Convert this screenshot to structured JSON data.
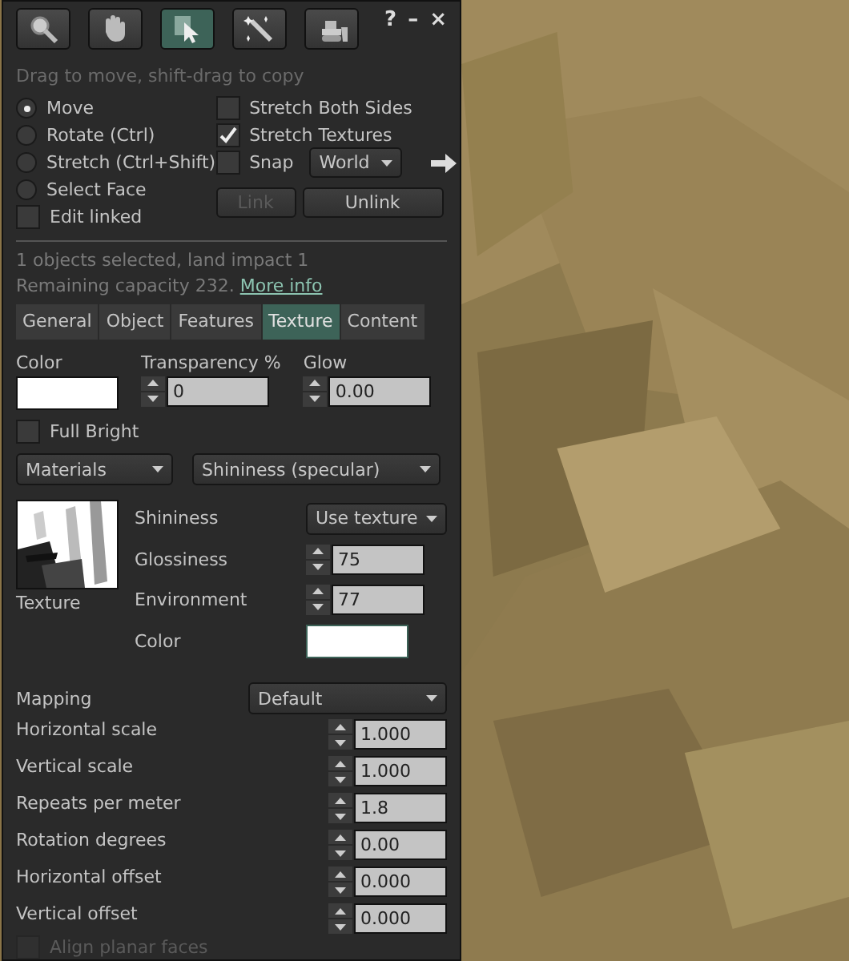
{
  "toolbar": {
    "tools": [
      {
        "kind": "zoom",
        "selected": false
      },
      {
        "kind": "grab",
        "selected": false
      },
      {
        "kind": "pointer",
        "selected": true
      },
      {
        "kind": "create",
        "selected": false
      },
      {
        "kind": "land",
        "selected": false
      }
    ],
    "window_buttons": [
      "?",
      "–",
      "×"
    ]
  },
  "hint": "Drag to move, shift-drag to copy",
  "modes": [
    {
      "label": "Move",
      "selected": true
    },
    {
      "label": "Rotate (Ctrl)",
      "selected": false
    },
    {
      "label": "Stretch (Ctrl+Shift)",
      "selected": false
    },
    {
      "label": "Select Face",
      "selected": false
    }
  ],
  "edit_linked": {
    "label": "Edit linked",
    "checked": false
  },
  "options": [
    {
      "label": "Stretch Both Sides",
      "checked": false
    },
    {
      "label": "Stretch Textures",
      "checked": true
    },
    {
      "label": "Snap",
      "checked": false
    }
  ],
  "snap_dropdown": {
    "value": "World"
  },
  "link_buttons": [
    {
      "label": "Link",
      "disabled": true
    },
    {
      "label": "Unlink",
      "disabled": false
    }
  ],
  "info": {
    "line_1": "1 objects selected, land impact 1",
    "line_2": "Remaining capacity 232.",
    "link": "More info"
  },
  "tabs": [
    {
      "label": "General",
      "selected": false
    },
    {
      "label": "Object",
      "selected": false
    },
    {
      "label": "Features",
      "selected": false
    },
    {
      "label": "Texture",
      "selected": true
    },
    {
      "label": "Content",
      "selected": false
    }
  ],
  "texture": {
    "color_label": "Color",
    "transparency": {
      "label": "Transparency %",
      "value": "0"
    },
    "glow": {
      "label": "Glow",
      "value": "0.00"
    },
    "full_bright": {
      "label": "Full Bright",
      "checked": false
    },
    "materials_dropdown": "Materials",
    "channel_dropdown": "Shininess (specular)",
    "texture_label": "Texture",
    "shininess": {
      "label": "Shininess",
      "value": "Use texture"
    },
    "glossiness": {
      "label": "Glossiness",
      "value": "75"
    },
    "environment": {
      "label": "Environment",
      "value": "77"
    },
    "specular_color_label": "Color",
    "mapping": {
      "label": "Mapping",
      "value": "Default"
    },
    "params": [
      {
        "label": "Horizontal scale",
        "value": "1.000"
      },
      {
        "label": "Vertical scale",
        "value": "1.000"
      },
      {
        "label": "Repeats per meter",
        "value": "1.8"
      },
      {
        "label": "Rotation degrees",
        "value": "0.00"
      },
      {
        "label": "Horizontal offset",
        "value": "0.000"
      },
      {
        "label": "Vertical offset",
        "value": "0.000"
      }
    ],
    "align_planar": {
      "label": "Align planar faces",
      "checked": false,
      "disabled": true
    }
  }
}
